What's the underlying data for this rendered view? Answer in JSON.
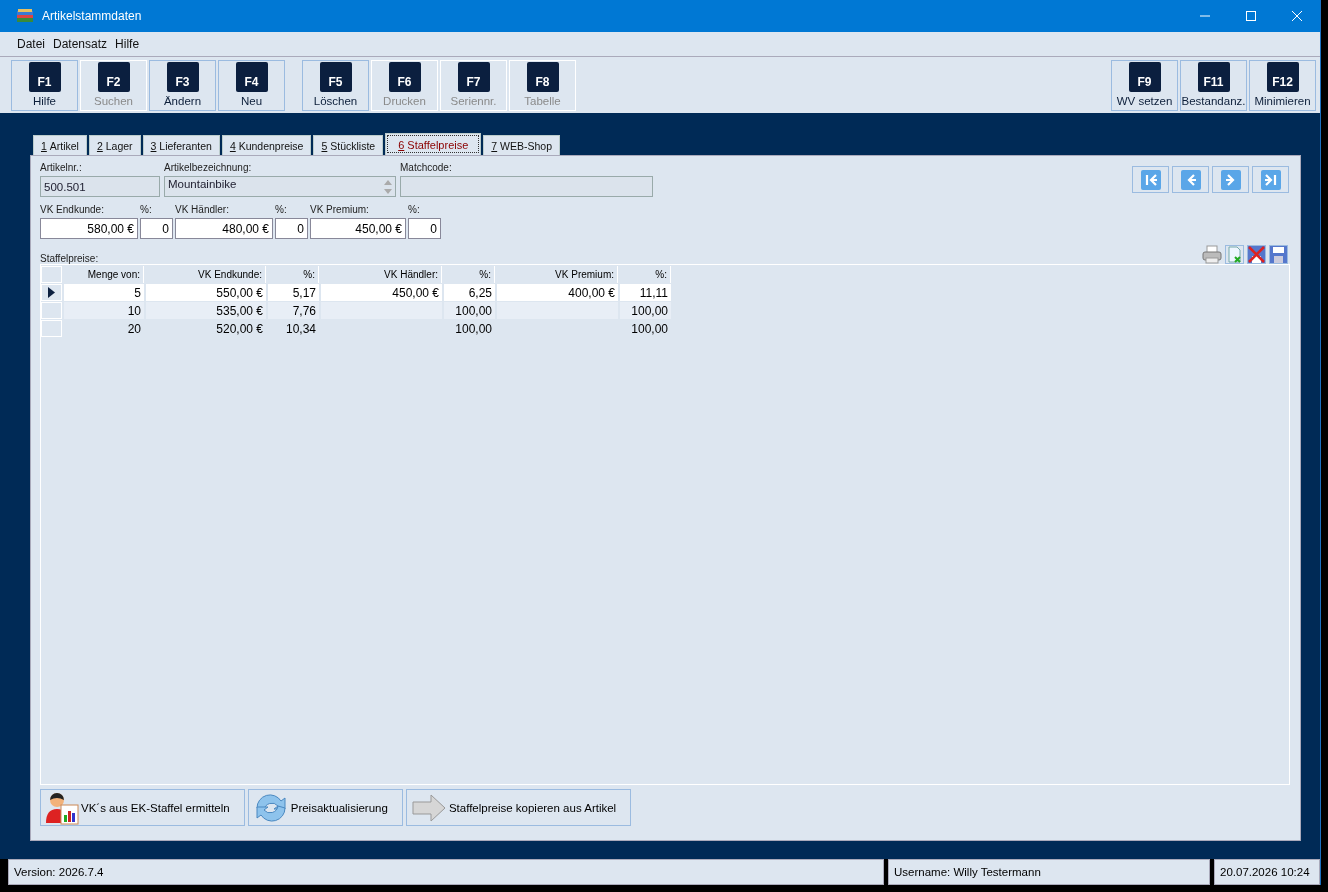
{
  "window": {
    "title": "Artikelstammdaten"
  },
  "menu": [
    "Datei",
    "Datensatz",
    "Hilfe"
  ],
  "toolbar": {
    "left_groups": [
      [
        {
          "key": "F1",
          "label": "Hilfe",
          "disabled": false
        },
        {
          "key": "F2",
          "label": "Suchen",
          "disabled": true
        },
        {
          "key": "F3",
          "label": "Ändern",
          "disabled": false
        },
        {
          "key": "F4",
          "label": "Neu",
          "disabled": false
        }
      ],
      [
        {
          "key": "F5",
          "label": "Löschen",
          "disabled": false
        },
        {
          "key": "F6",
          "label": "Drucken",
          "disabled": true
        },
        {
          "key": "F7",
          "label": "Seriennr.",
          "disabled": true
        },
        {
          "key": "F8",
          "label": "Tabelle",
          "disabled": true
        }
      ]
    ],
    "right": [
      {
        "key": "F9",
        "label": "WV setzen",
        "disabled": false
      },
      {
        "key": "F11",
        "label": "Bestandanz.",
        "disabled": false
      },
      {
        "key": "F12",
        "label": "Minimieren",
        "disabled": false
      }
    ]
  },
  "tabs": [
    {
      "key": "1",
      "label": "Artikel",
      "selected": false
    },
    {
      "key": "2",
      "label": "Lager",
      "selected": false
    },
    {
      "key": "3",
      "label": "Lieferanten",
      "selected": false
    },
    {
      "key": "4",
      "label": "Kundenpreise",
      "selected": false
    },
    {
      "key": "5",
      "label": "Stückliste",
      "selected": false
    },
    {
      "key": "6",
      "label": "Staffelpreise",
      "selected": true
    },
    {
      "key": "7",
      "label": "WEB-Shop",
      "selected": false
    }
  ],
  "article": {
    "number_label": "Artikelnr.:",
    "number": "500.501",
    "name_label": "Artikelbezeichnung:",
    "name": "Mountainbike",
    "matchcode_label": "Matchcode:"
  },
  "prices": [
    {
      "label": "VK Endkunde:",
      "value": "580,00 €",
      "pct_label": "%:",
      "pct": "0"
    },
    {
      "label": "VK Händler:",
      "value": "480,00 €",
      "pct_label": "%:",
      "pct": "0"
    },
    {
      "label": "VK Premium:",
      "value": "450,00 €",
      "pct_label": "%:",
      "pct": "0"
    }
  ],
  "grid": {
    "title": "Staffelpreise:",
    "columns": [
      "Menge von:",
      "VK Endkunde:",
      "%:",
      "VK Händler:",
      "%:",
      "VK Premium:",
      "%:"
    ],
    "rows": [
      {
        "selected": true,
        "cells": [
          "5",
          "550,00 €",
          "5,17",
          "450,00 €",
          "6,25",
          "400,00 €",
          "11,11"
        ]
      },
      {
        "selected": false,
        "cells": [
          "10",
          "535,00 €",
          "7,76",
          null,
          "100,00",
          null,
          "100,00"
        ]
      },
      {
        "selected": false,
        "cells": [
          "20",
          "520,00 €",
          "10,34",
          null,
          "100,00",
          null,
          "100,00"
        ]
      }
    ]
  },
  "actions": [
    {
      "kind": "person",
      "label": "VK´s aus EK-Staffel ermitteln"
    },
    {
      "kind": "refresh",
      "label": "Preisaktualisierung"
    },
    {
      "kind": "arrow",
      "label": "Staffelpreise kopieren aus Artikel"
    }
  ],
  "status_bar": {
    "version": "Version: 2026.7.4",
    "user": "Username: Willy Testermann",
    "datetime": "20.07.2026 10:24"
  }
}
